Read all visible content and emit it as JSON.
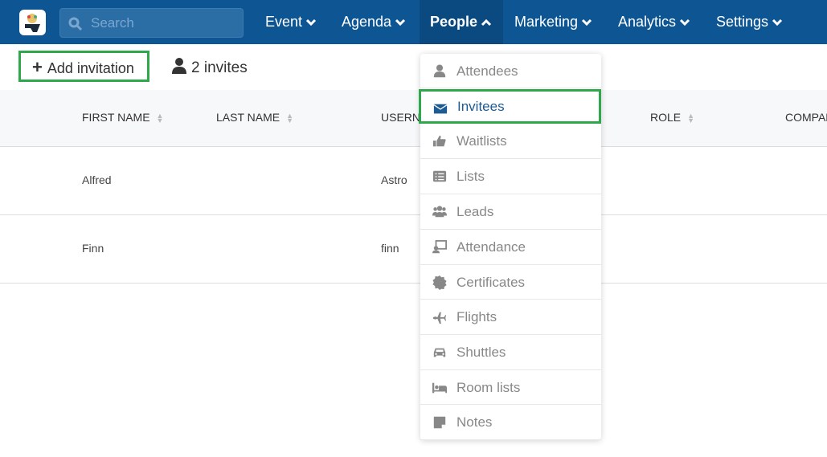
{
  "nav": {
    "search_placeholder": "Search",
    "menus": [
      {
        "label": "Event",
        "expanded": false
      },
      {
        "label": "Agenda",
        "expanded": false
      },
      {
        "label": "People",
        "expanded": true
      },
      {
        "label": "Marketing",
        "expanded": false
      },
      {
        "label": "Analytics",
        "expanded": false
      },
      {
        "label": "Settings",
        "expanded": false
      }
    ]
  },
  "toolbar": {
    "add_label": "Add invitation",
    "count_label": "2 invites"
  },
  "table": {
    "columns": [
      "FIRST NAME",
      "LAST NAME",
      "USERNAME",
      "",
      "ROLE",
      "COMPANY"
    ],
    "rows": [
      {
        "first": "Alfred",
        "last": "",
        "username": "Astro"
      },
      {
        "first": "Finn",
        "last": "",
        "username": "finn"
      }
    ]
  },
  "people_menu": {
    "items": [
      {
        "label": "Attendees",
        "icon": "user-icon"
      },
      {
        "label": "Invitees",
        "icon": "envelope-icon",
        "selected": true
      },
      {
        "label": "Waitlists",
        "icon": "thumbs-up-icon"
      },
      {
        "label": "Lists",
        "icon": "list-icon"
      },
      {
        "label": "Leads",
        "icon": "users-icon"
      },
      {
        "label": "Attendance",
        "icon": "attendance-icon"
      },
      {
        "label": "Certificates",
        "icon": "certificate-icon"
      },
      {
        "label": "Flights",
        "icon": "plane-icon"
      },
      {
        "label": "Shuttles",
        "icon": "car-icon"
      },
      {
        "label": "Room lists",
        "icon": "bed-icon"
      },
      {
        "label": "Notes",
        "icon": "note-icon"
      }
    ]
  },
  "colors": {
    "nav": "#0e5693",
    "highlight": "#2ea84a",
    "selected_text": "#1d5b92"
  }
}
